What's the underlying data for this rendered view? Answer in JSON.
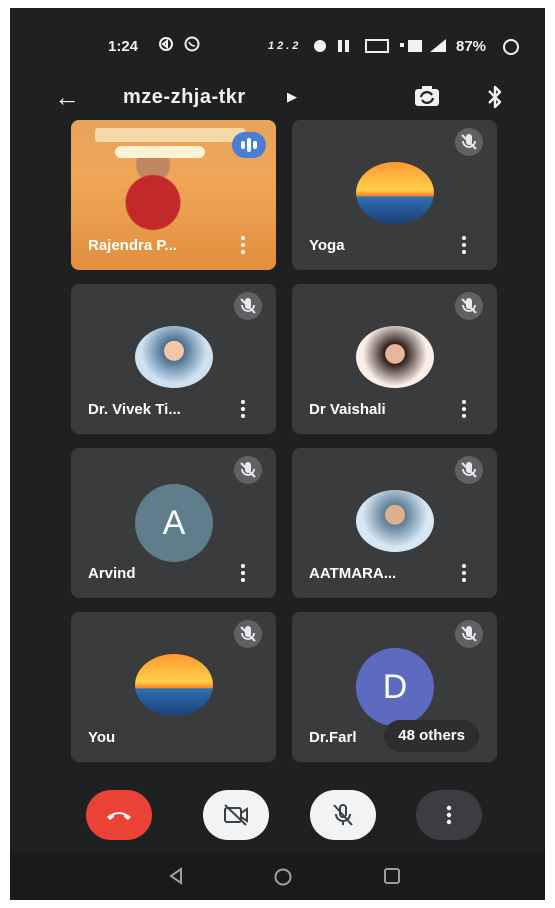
{
  "status_bar": {
    "time": "1:24",
    "network_text": "12.2",
    "battery": "87%"
  },
  "header": {
    "meeting_code": "mze-zhja-tkr",
    "back_icon": "arrow-left-icon",
    "switch_camera_icon": "camera-switch-icon",
    "bluetooth_icon": "bluetooth-icon"
  },
  "participants": [
    {
      "name": "Rajendra P...",
      "muted": false,
      "speaking": true,
      "kind": "video"
    },
    {
      "name": "Yoga",
      "muted": true,
      "kind": "photo-sunset"
    },
    {
      "name": "Dr. Vivek Ti...",
      "muted": true,
      "kind": "photo"
    },
    {
      "name": "Dr Vaishali",
      "muted": true,
      "kind": "photo"
    },
    {
      "name": "Arvind",
      "muted": true,
      "kind": "letter",
      "initial": "A",
      "color": "#607d8b"
    },
    {
      "name": "AATMARA...",
      "muted": true,
      "kind": "photo"
    },
    {
      "name": "You",
      "muted": true,
      "kind": "photo-sunset"
    },
    {
      "name": "Dr.Farl",
      "muted": true,
      "kind": "letter",
      "initial": "D",
      "color": "#5c6bc0"
    }
  ],
  "others_chip": "48 others",
  "controls": {
    "end_call_icon": "phone-hangup-icon",
    "camera_icon": "camera-off-icon",
    "mic_icon": "mic-off-icon",
    "more_icon": "more-vertical-icon",
    "end_color": "#ea4335"
  },
  "nav": {
    "back": "nav-back-icon",
    "home": "nav-home-icon",
    "recents": "nav-recents-icon"
  }
}
